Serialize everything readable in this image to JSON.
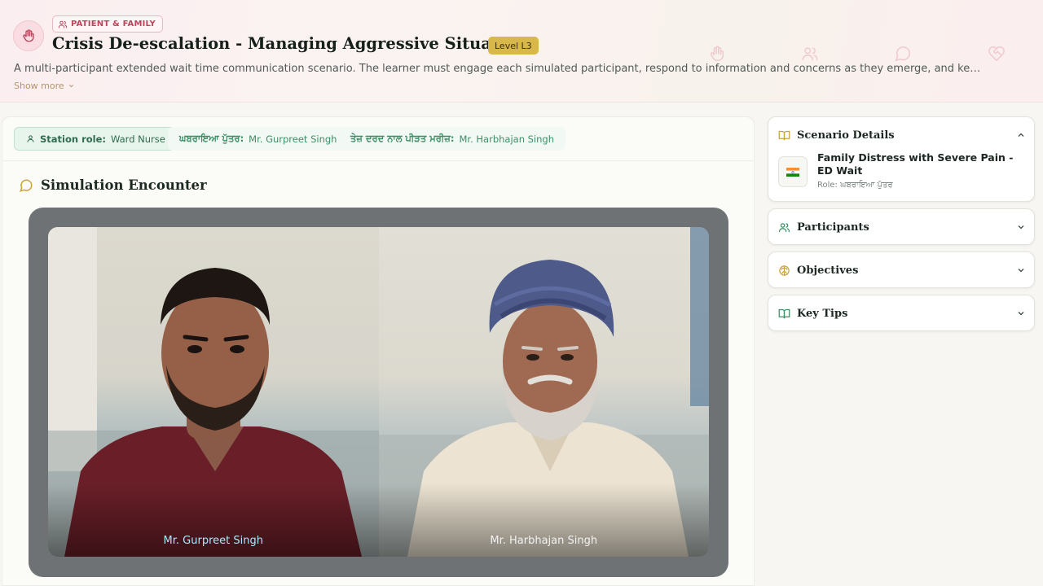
{
  "header": {
    "category": "PATIENT & FAMILY",
    "title": "Crisis De-escalation - Managing Aggressive Situations",
    "level": "Level L3",
    "description": "A multi-participant extended wait time communication scenario. The learner must engage each simulated participant, respond to information and concerns as they emerge, and keep the…",
    "show_more": "Show more",
    "icons": [
      "hand-icon",
      "users-icon",
      "chat-icon",
      "heart-handshake-icon"
    ]
  },
  "roles": [
    {
      "label": "Station role:",
      "value": "Ward Nurse"
    },
    {
      "label": "ਘਬਰਾਇਆ ਪੁੱਤਰ:",
      "value": "Mr. Gurpreet Singh"
    },
    {
      "label": "ਤੇਜ਼ ਦਰਦ ਨਾਲ ਪੀੜਤ ਮਰੀਜ਼:",
      "value": "Mr. Harbhajan Singh"
    }
  ],
  "encounter": {
    "title": "Simulation Encounter",
    "participants": [
      {
        "name": "Mr. Gurpreet Singh",
        "speaking": true
      },
      {
        "name": "Mr. Harbhajan Singh",
        "speaking": false
      }
    ]
  },
  "sidebar": {
    "scenario_details": {
      "title": "Scenario Details",
      "expanded": true,
      "scenario_name": "Family Distress with Severe Pain - ED Wait",
      "role": "Role: ਘਬਰਾਇਆ ਪੁੱਤਰ",
      "flag_icon": "india-flag-icon"
    },
    "sections": [
      {
        "title": "Participants",
        "icon": "users-icon"
      },
      {
        "title": "Objectives",
        "icon": "brain-icon"
      },
      {
        "title": "Key Tips",
        "icon": "book-icon"
      }
    ]
  },
  "colors": {
    "accent_green": "#3d8f66",
    "accent_gold": "#d8b84a",
    "accent_pink": "#b8465b"
  }
}
